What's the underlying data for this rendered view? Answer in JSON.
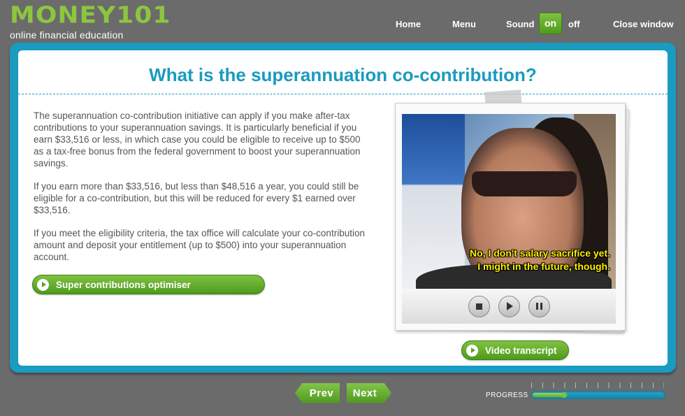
{
  "brand": {
    "name": "MONEY101",
    "tagline": "online financial education"
  },
  "topnav": {
    "home": "Home",
    "menu": "Menu",
    "sound": "Sound",
    "sound_on": "on",
    "sound_off": "off",
    "close": "Close window"
  },
  "page": {
    "title": "What is the superannuation co-contribution?",
    "paragraphs": [
      "The superannuation co-contribution initiative can apply if you make after-tax contributions to your superannuation savings. It is particularly beneficial if you earn $33,516 or less, in which case you could be eligible to receive up to $500 as a tax-free bonus from the federal government to boost your superannuation savings.",
      "If you earn more than $33,516, but less than $48,516 a year, you could still be eligible for a co-contribution, but this will be reduced for every $1 earned over $33,516.",
      "If you meet the eligibility criteria, the tax office will calculate your co-contribution amount and deposit your entitlement (up to $500) into your superannuation account."
    ],
    "optimiser_button": "Super contributions optimiser"
  },
  "video": {
    "subtitle_line1": "No, I don't salary sacrifice yet.",
    "subtitle_line2": "I might in the future, though.",
    "transcript_button": "Video transcript"
  },
  "footer": {
    "prev": "Prev",
    "next": "Next",
    "progress_label": "PROGRESS",
    "progress_fraction": 0.25
  },
  "colors": {
    "accent_blue": "#1a9bbf",
    "accent_green": "#8cc63f",
    "background": "#6b6b6b"
  }
}
